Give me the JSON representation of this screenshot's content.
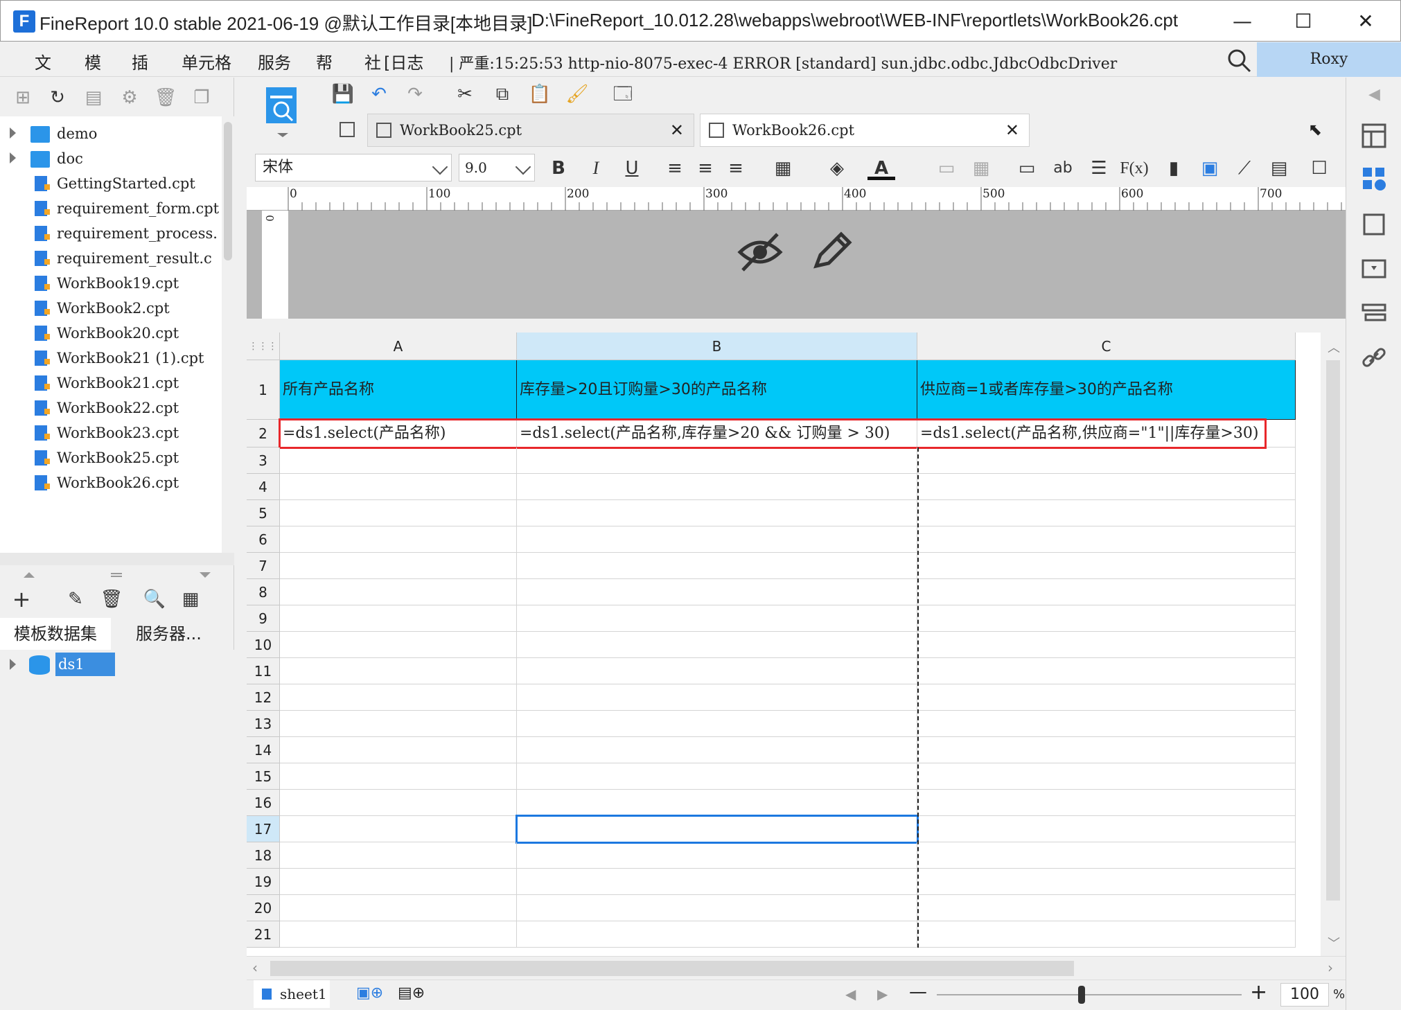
{
  "window": {
    "title": "FineReport 10.0 stable 2021-06-19 @默认工作目录[本地目录]",
    "path": "D:\\FineReport_10.012.28\\webapps\\webroot\\WEB-INF\\reportlets\\WorkBook26.cpt",
    "minimize": "—",
    "maximize": "☐",
    "close": "✕"
  },
  "menu": {
    "items": [
      "文 ",
      "模 ",
      "插 ",
      "单元格",
      "服务",
      "帮 ",
      "社 "
    ],
    "log_label": "[日志",
    "log_text": "| 严重:15:25:53 http-nio-8075-exec-4 ERROR [standard] sun.jdbc.odbc.JdbcOdbcDriver",
    "user": "Roxy"
  },
  "tree": {
    "items": [
      {
        "label": "demo",
        "type": "folder"
      },
      {
        "label": "doc",
        "type": "folder"
      },
      {
        "label": "GettingStarted.cpt",
        "type": "file"
      },
      {
        "label": "requirement_form.cpt",
        "type": "file"
      },
      {
        "label": "requirement_process.",
        "type": "file"
      },
      {
        "label": "requirement_result.c",
        "type": "file"
      },
      {
        "label": "WorkBook19.cpt",
        "type": "file"
      },
      {
        "label": "WorkBook2.cpt",
        "type": "file"
      },
      {
        "label": "WorkBook20.cpt",
        "type": "file"
      },
      {
        "label": "WorkBook21 (1).cpt",
        "type": "file"
      },
      {
        "label": "WorkBook21.cpt",
        "type": "file"
      },
      {
        "label": "WorkBook22.cpt",
        "type": "file"
      },
      {
        "label": "WorkBook23.cpt",
        "type": "file"
      },
      {
        "label": "WorkBook25.cpt",
        "type": "file"
      },
      {
        "label": "WorkBook26.cpt",
        "type": "file"
      }
    ]
  },
  "datasets": {
    "tab_template": "模板数据集",
    "tab_server": "服务器...",
    "ds1": "ds1"
  },
  "tabs": [
    {
      "label": "WorkBook25.cpt",
      "close": "✕",
      "active": false
    },
    {
      "label": "WorkBook26.cpt",
      "close": "✕",
      "active": true
    }
  ],
  "format": {
    "font": "宋体",
    "size": "9.0",
    "bold": "B",
    "italic": "I",
    "underline": "U",
    "text_a": "A",
    "ab": "ab",
    "fx": "F(x)"
  },
  "ruler": {
    "marks": [
      "0",
      "100",
      "200",
      "300",
      "400",
      "500",
      "600",
      "700"
    ],
    "vertical_zero": "0"
  },
  "grid": {
    "columns": [
      "A",
      "B",
      "C"
    ],
    "rows": [
      "1",
      "2",
      "3",
      "4",
      "5",
      "6",
      "7",
      "8",
      "9",
      "10",
      "11",
      "12",
      "13",
      "14",
      "15",
      "16",
      "17",
      "18",
      "19",
      "20",
      "21"
    ],
    "row1": [
      "所有产品名称",
      "库存量>20且订购量>30的产品名称",
      "供应商=1或者库存量>30的产品名称"
    ],
    "row2": [
      "=ds1.select(产品名称)",
      "=ds1.select(产品名称,库存量>20 && 订购量 > 30)",
      "=ds1.select(产品名称,供应商=\"1\"||库存量>30)"
    ],
    "selected_row": "17",
    "selected_col": "B"
  },
  "status": {
    "sheet": "sheet1",
    "zoom": "100",
    "zoom_unit": "%",
    "zoom_minus": "—",
    "zoom_plus": "+"
  },
  "colors": {
    "header_fill": "#00c8f8",
    "red_outline": "#e8272b",
    "selection": "#1c78e0"
  }
}
